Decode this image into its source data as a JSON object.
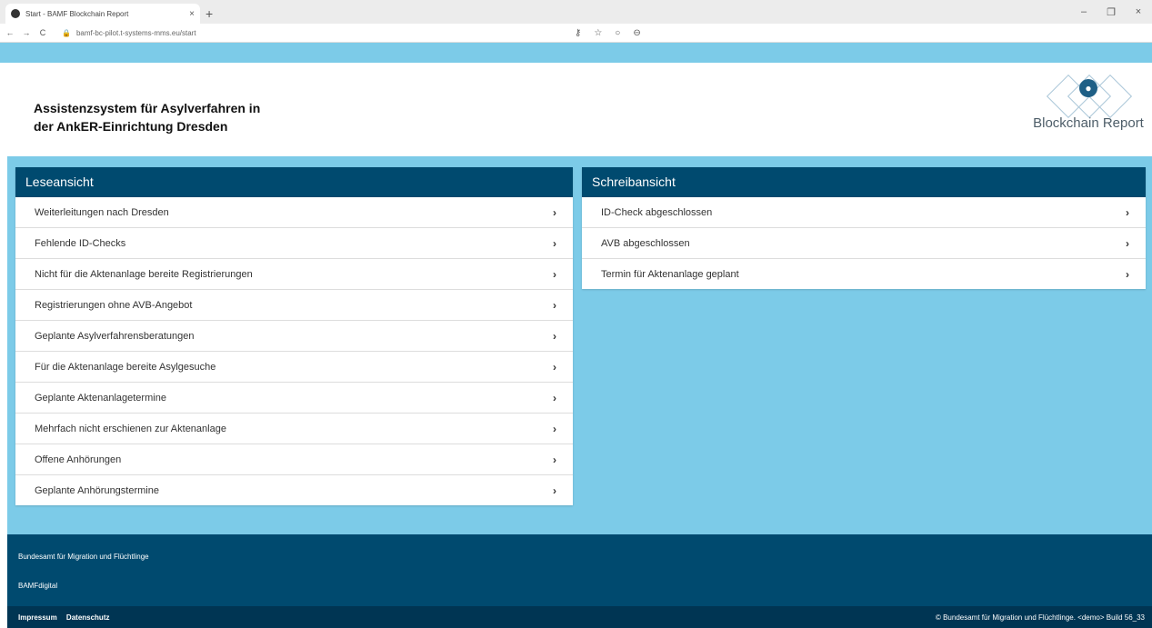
{
  "browser": {
    "tab_title": "Start - BAMF Blockchain Report",
    "tab_close": "×",
    "new_tab": "+",
    "url": "bamf-bc-pilot.t-systems-mms.eu/start",
    "win_min": "–",
    "win_max": "❐",
    "win_close": "×"
  },
  "header": {
    "title_line1": "Assistenzsystem für Asylverfahren in",
    "title_line2": "der AnkER-Einrichtung Dresden",
    "logo_text": "Blockchain Report"
  },
  "left_panel": {
    "title": "Leseansicht",
    "items": [
      {
        "label": "Weiterleitungen nach Dresden"
      },
      {
        "label": "Fehlende ID-Checks"
      },
      {
        "label": "Nicht für die Aktenanlage bereite Registrierungen"
      },
      {
        "label": "Registrierungen ohne AVB-Angebot"
      },
      {
        "label": "Geplante Asylverfahrensberatungen"
      },
      {
        "label": "Für die Aktenanlage bereite Asylgesuche"
      },
      {
        "label": "Geplante Aktenanlagetermine"
      },
      {
        "label": "Mehrfach nicht erschienen zur Aktenanlage"
      },
      {
        "label": "Offene Anhörungen"
      },
      {
        "label": "Geplante Anhörungstermine"
      }
    ]
  },
  "right_panel": {
    "title": "Schreibansicht",
    "items": [
      {
        "label": "ID-Check abgeschlossen"
      },
      {
        "label": "AVB abgeschlossen"
      },
      {
        "label": "Termin für Aktenanlage geplant"
      }
    ]
  },
  "chevron": "›",
  "footer": {
    "org": "Bundesamt für Migration und Flüchtlinge",
    "unit": "BAMFdigital",
    "link_impressum": "Impressum",
    "link_datenschutz": "Datenschutz",
    "copyright": "© Bundesamt für Migration und Flüchtlinge. <demo> Build 56_33"
  },
  "colors": {
    "accent_light": "#7ccbe8",
    "header_dark": "#004a6f",
    "bottom_dark": "#003553"
  }
}
